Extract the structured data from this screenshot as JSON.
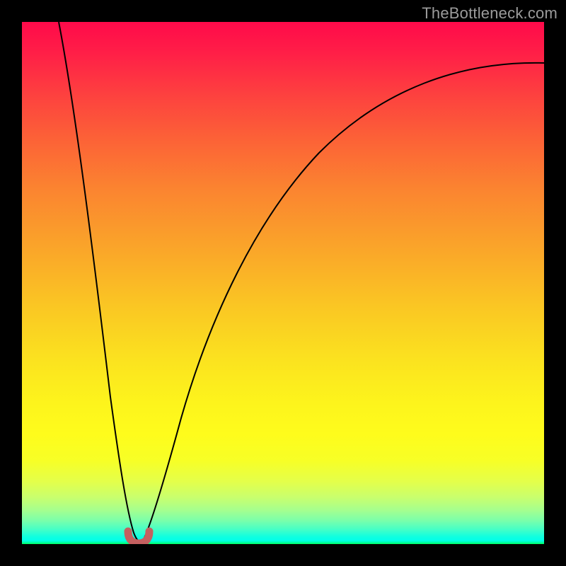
{
  "watermark": "TheBottleneck.com",
  "chart_data": {
    "type": "line",
    "title": "",
    "xlabel": "",
    "ylabel": "",
    "xlim": [
      0,
      100
    ],
    "ylim": [
      0,
      100
    ],
    "grid": false,
    "notes": "Background is a vertical color gradient from red (top) through orange/yellow to green (bottom). Two black curves descend from the top; the left one drops sharply to a minimum near x≈20 with a short rounded red/brown segment at the very bottom, and the right curve rises and flattens toward the right edge. No axis ticks or numeric labels are visible; values below are estimated from geometry.",
    "series": [
      {
        "name": "left-branch",
        "x": [
          7,
          10,
          13,
          16,
          18,
          19.5,
          20.5,
          22,
          23
        ],
        "y": [
          100,
          75,
          50,
          25,
          10,
          3,
          1,
          0.3,
          0.4
        ]
      },
      {
        "name": "right-branch",
        "x": [
          23,
          24,
          26,
          30,
          35,
          42,
          50,
          60,
          72,
          85,
          100
        ],
        "y": [
          0.4,
          1,
          5,
          18,
          35,
          52,
          65,
          76,
          84,
          89,
          92
        ]
      },
      {
        "name": "minimum-marker",
        "x": [
          20,
          21,
          22,
          23,
          24
        ],
        "y": [
          1.6,
          0.4,
          0.2,
          0.4,
          1.6
        ]
      }
    ],
    "gradient_stops": [
      {
        "pos": 0.0,
        "color": "#ff0a4a"
      },
      {
        "pos": 0.3,
        "color": "#fb8430"
      },
      {
        "pos": 0.6,
        "color": "#fbe31f"
      },
      {
        "pos": 0.9,
        "color": "#c9ff6d"
      },
      {
        "pos": 1.0,
        "color": "#00ff5e"
      }
    ]
  }
}
